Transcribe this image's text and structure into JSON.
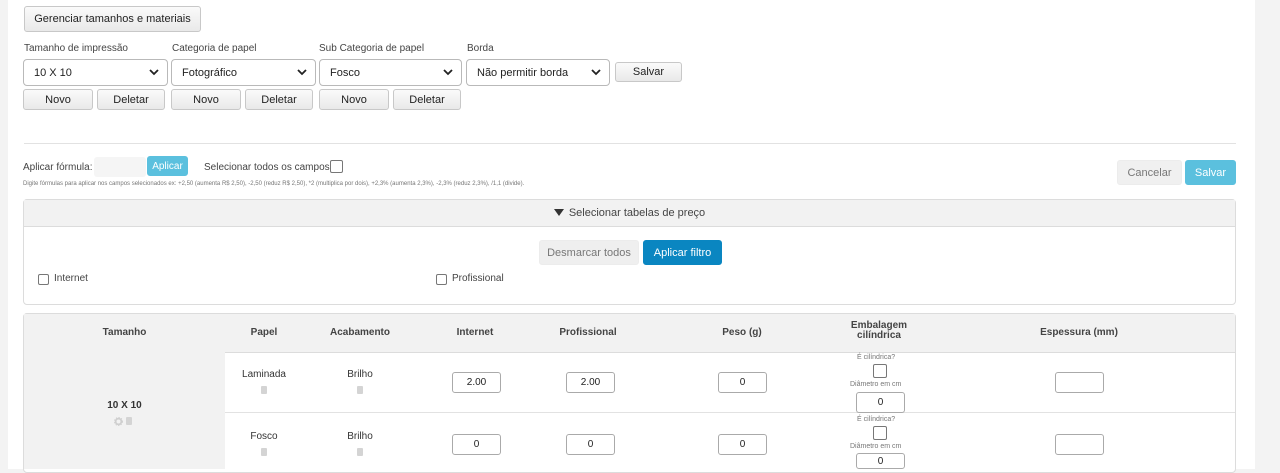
{
  "top": {
    "manage_label": "Gerenciar tamanhos e materiais"
  },
  "filters": {
    "size": {
      "label": "Tamanho de impressão",
      "value": "10 X 10"
    },
    "paper_category": {
      "label": "Categoria de papel",
      "value": "Fotográfico"
    },
    "paper_subcategory": {
      "label": "Sub Categoria de papel",
      "value": "Fosco"
    },
    "border": {
      "label": "Borda",
      "value": "Não permitir borda"
    },
    "save_label": "Salvar",
    "new_label": "Novo",
    "delete_label": "Deletar"
  },
  "formula": {
    "label": "Aplicar fórmula:",
    "apply_label": "Aplicar",
    "select_all_label": "Selecionar todos os campos:",
    "hint": "Digite fórmulas para aplicar nos campos selecionados ex: +2,50 (aumenta R$ 2,50), -2,50 (reduz R$ 2,50), *2 (multiplica por dois), +2,3% (aumenta 2,3%), -2,3% (reduz 2,3%), /1,1 (divide).",
    "cancel_label": "Cancelar",
    "save_label": "Salvar"
  },
  "price_tables": {
    "header_label": "Selecionar tabelas de preço",
    "uncheck_all_label": "Desmarcar todos",
    "apply_filter_label": "Aplicar filtro",
    "options": [
      "Internet",
      "Profissional"
    ]
  },
  "table": {
    "headers": {
      "size": "Tamanho",
      "paper": "Papel",
      "finish": "Acabamento",
      "internet": "Internet",
      "profissional": "Profissional",
      "weight": "Peso (g)",
      "packaging_line1": "Embalagem",
      "packaging_line2": "cilíndrica",
      "thickness": "Espessura (mm)"
    },
    "size_value": "10 X 10",
    "cylindrical_question": "É cilíndrica?",
    "diameter_label": "Diâmetro em cm",
    "rows": [
      {
        "paper": "Laminada",
        "finish": "Brilho",
        "internet": "2.00",
        "profissional": "2.00",
        "weight": "0",
        "diameter": "0",
        "thickness": ""
      },
      {
        "paper": "Fosco",
        "finish": "Brilho",
        "internet": "0",
        "profissional": "0",
        "weight": "0",
        "diameter": "0",
        "thickness": ""
      }
    ]
  },
  "colors": {
    "accent_blue": "#0a86c1",
    "light_blue": "#5bc0de",
    "header_bg": "#f2f2f2"
  }
}
